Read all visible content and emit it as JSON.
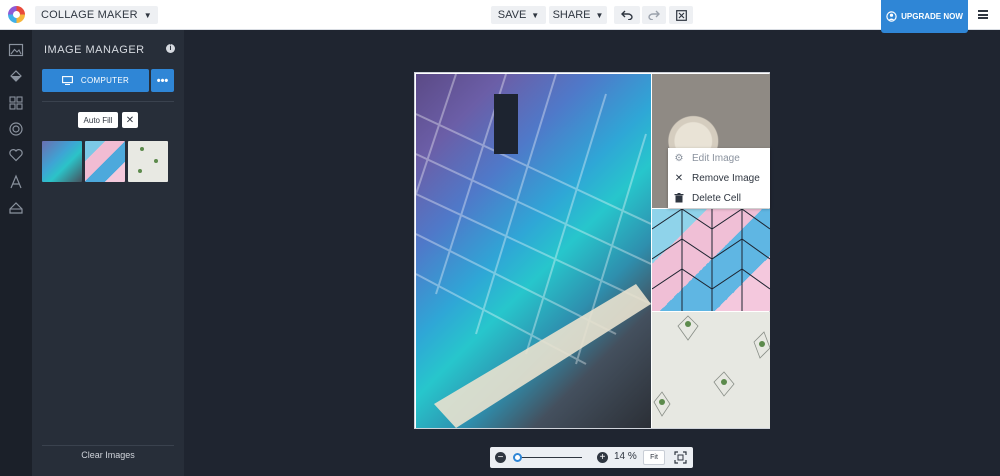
{
  "app": {
    "menu_label": "COLLAGE MAKER"
  },
  "toolbar": {
    "save_label": "SAVE",
    "share_label": "SHARE",
    "upgrade_label": "UPGRADE NOW"
  },
  "panel": {
    "title": "IMAGE MANAGER",
    "computer_label": "COMPUTER",
    "autofill_label": "Auto Fill",
    "clear_label": "Clear Images"
  },
  "context_menu": {
    "items": [
      {
        "label": "Edit Image",
        "icon": "sliders-icon",
        "disabled": true
      },
      {
        "label": "Remove Image",
        "icon": "close-icon",
        "disabled": false
      },
      {
        "label": "Delete Cell",
        "icon": "trash-icon",
        "disabled": false
      }
    ]
  },
  "zoom": {
    "value": "14 %",
    "fit_label": "Fit",
    "slider_level": 0.05
  },
  "colors": {
    "accent": "#2f86d6",
    "panel_bg": "#272e39",
    "canvas_bg": "#1f2530"
  }
}
